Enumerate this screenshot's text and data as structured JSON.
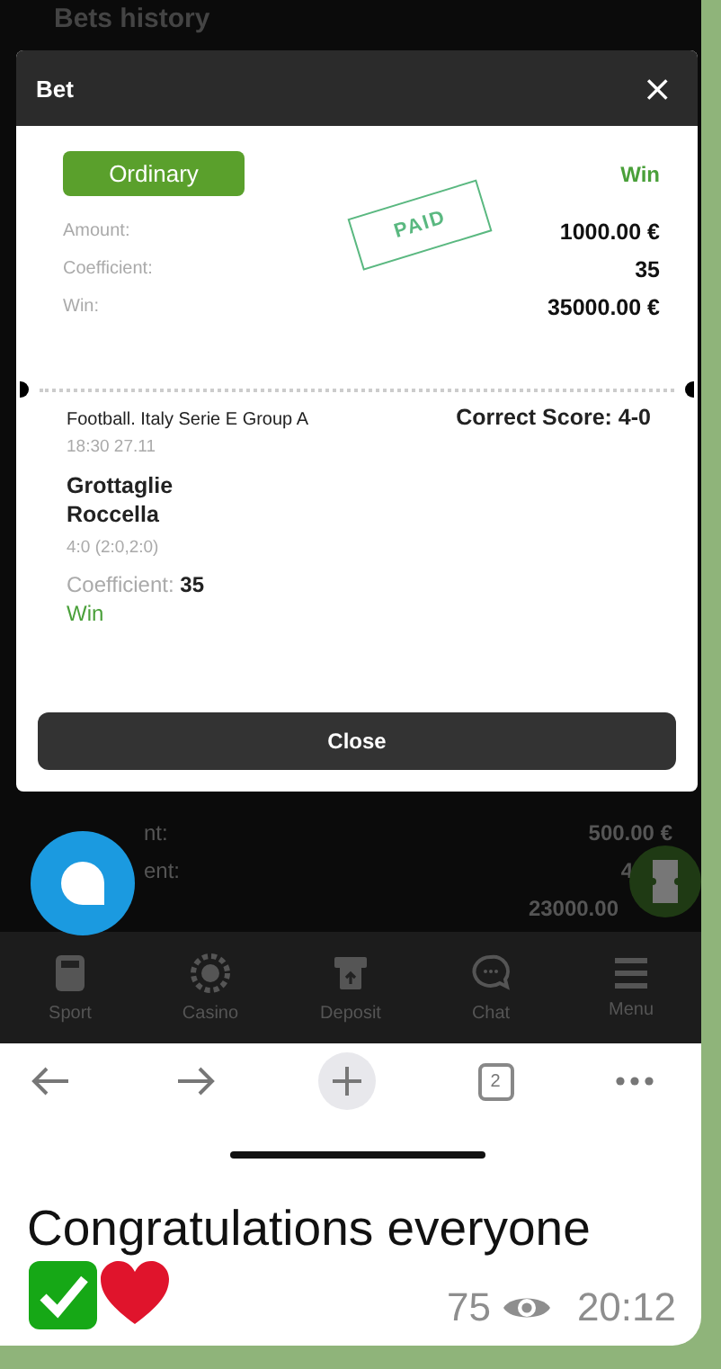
{
  "background_header": {
    "title": "Bets history"
  },
  "modal": {
    "title": "Bet",
    "close": "×"
  },
  "bet": {
    "type": "Ordinary",
    "status": "Win",
    "stamp": "PAID",
    "rows": [
      {
        "label": "Amount:",
        "value": "1000.00 €"
      },
      {
        "label": "Coefficient:",
        "value": "35"
      },
      {
        "label": "Win:",
        "value": "35000.00 €"
      }
    ]
  },
  "event": {
    "league": "Football. Italy Serie E Group A",
    "time": "18:30 27.11",
    "market": "Correct Score: 4-0",
    "teams": [
      "Grottaglie",
      "Roccella"
    ],
    "score": "4:0 (2:0,2:0)",
    "coefficient": "Coefficient: **35**",
    "result": "Win"
  },
  "close_button": "Close",
  "background_rows": [
    {
      "label": "nt:",
      "value": "500.00 €"
    },
    {
      "label": "ent:",
      "value": "4"
    },
    {
      "value": "23000.00"
    }
  ],
  "bottom_nav": [
    {
      "kind": "sport",
      "label": "Sport"
    },
    {
      "kind": "casino",
      "label": "Casino"
    },
    {
      "kind": "deposit",
      "label": "Deposit"
    },
    {
      "kind": "chat",
      "label": "Chat"
    },
    {
      "kind": "menu",
      "label": "Menu"
    }
  ],
  "browser_toolbar": {
    "tab_count": "2"
  },
  "message": {
    "text": "Congratulations everyone",
    "views": "75",
    "time": "20:12"
  }
}
